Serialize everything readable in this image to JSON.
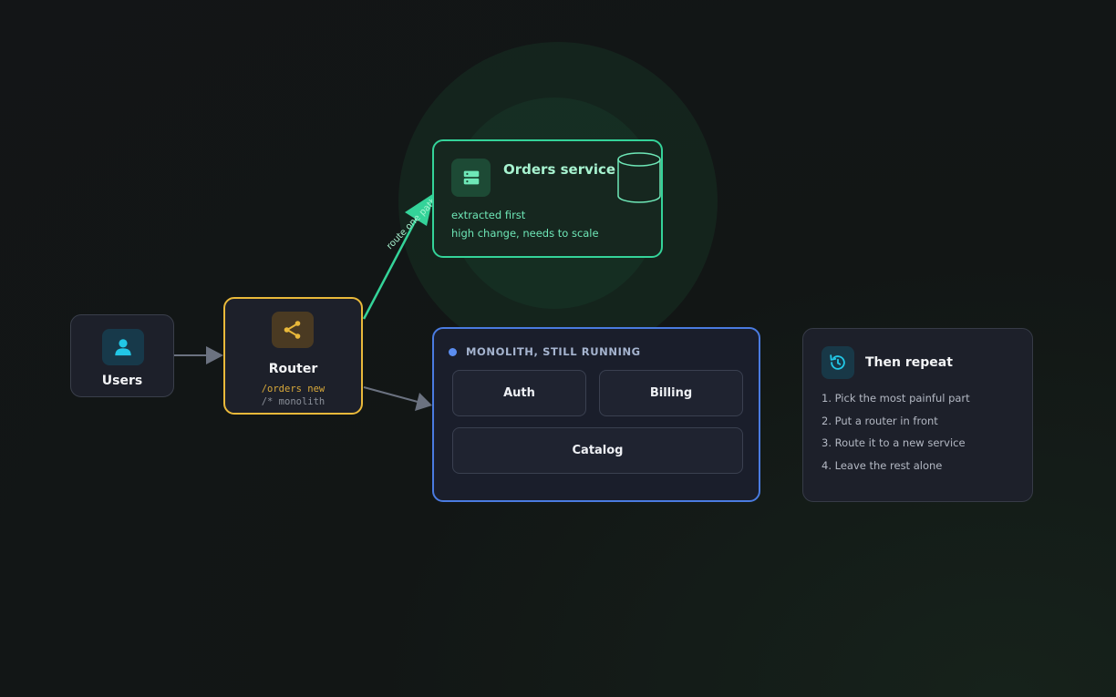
{
  "colors": {
    "green": "#34d399",
    "amber": "#e9b93a",
    "blue": "#4a7be0",
    "cyan": "#22c7e6",
    "edge": "#6b7280"
  },
  "nodes": {
    "users": {
      "label": "Users",
      "icon": "user-icon"
    },
    "router": {
      "label": "Router",
      "icon": "share-icon",
      "route_new": "/orders new",
      "route_mono": "/* monolith"
    },
    "orders": {
      "title": "Orders service",
      "icon": "server-icon",
      "line1": "extracted first",
      "line2": "high change, needs to scale",
      "db_icon": "database-icon"
    },
    "monolith": {
      "heading": "MONOLITH, STILL RUNNING",
      "modules": [
        "Auth",
        "Billing",
        "Catalog"
      ]
    },
    "repeat": {
      "title": "Then repeat",
      "icon": "rotate-ccw-icon",
      "steps": [
        "1. Pick the most painful part",
        "2. Put a router in front",
        "3. Route it to a new service",
        "4. Leave the rest alone"
      ]
    }
  },
  "edges": {
    "users_router": "",
    "router_orders": "route one path out",
    "router_monolith": ""
  }
}
